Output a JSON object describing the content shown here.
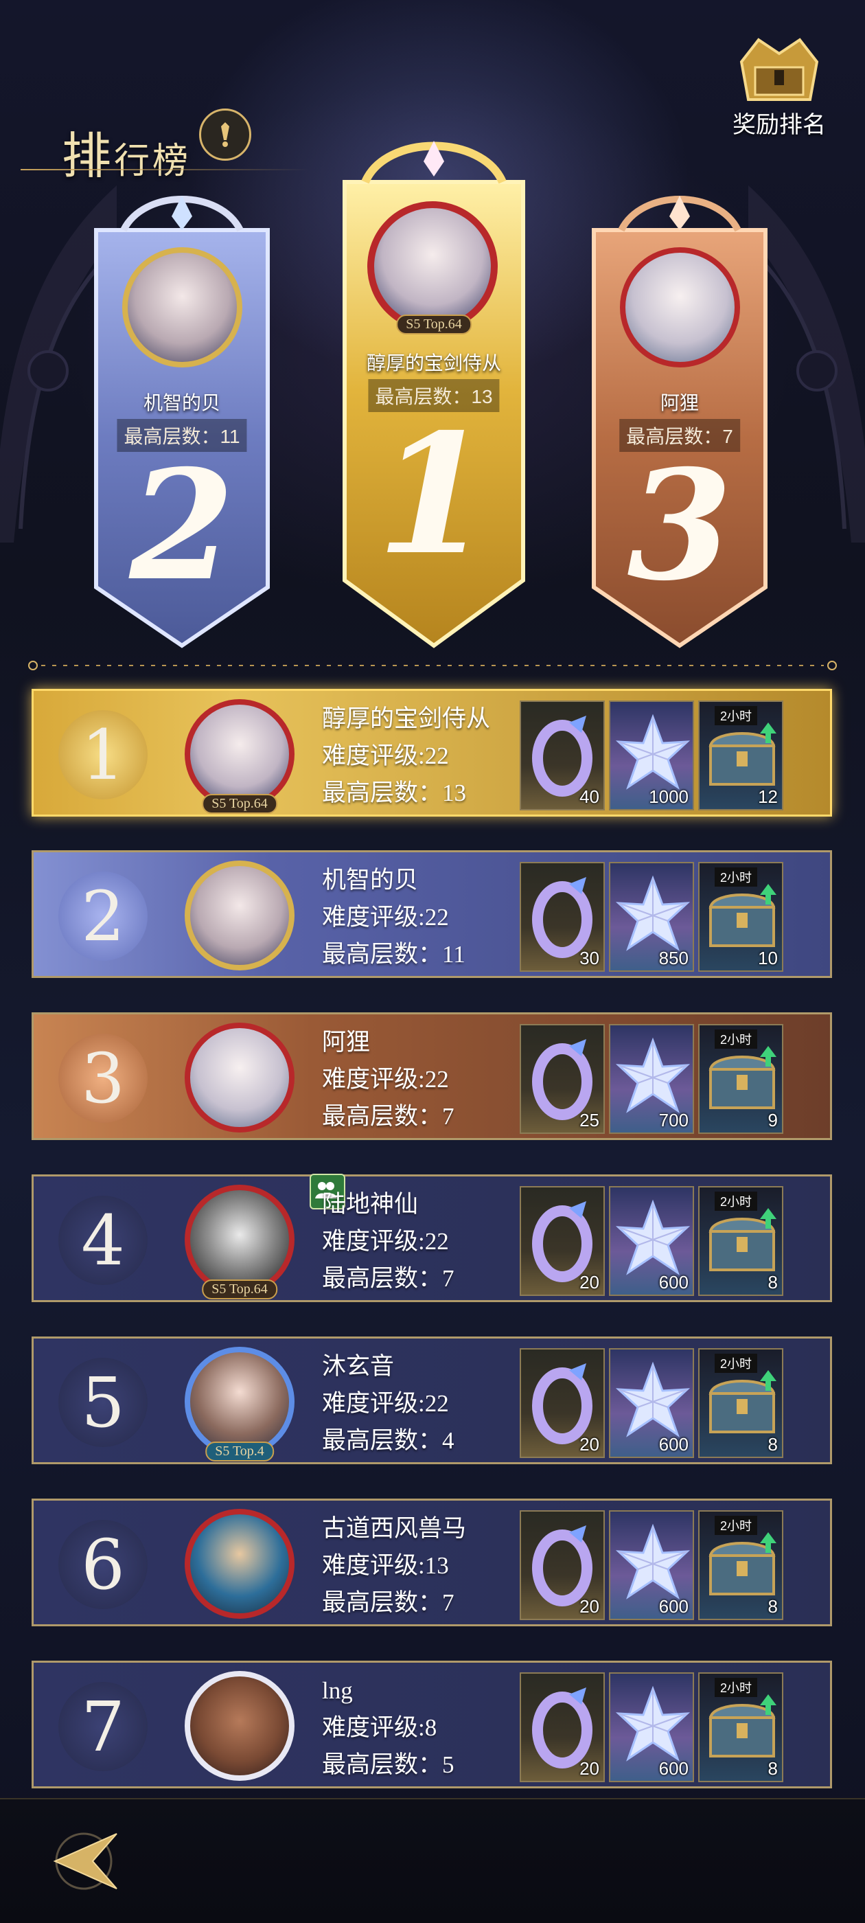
{
  "header": {
    "title_first": "排",
    "title_rest": "行榜",
    "info_icon": "exclamation-icon"
  },
  "reward_rank": {
    "label": "奖励排名",
    "icon": "treasure-chest-icon"
  },
  "podium": [
    {
      "rank": "2",
      "name": "机智的贝",
      "floor": "最高层数：11",
      "badge": ""
    },
    {
      "rank": "1",
      "name": "醇厚的宝剑侍从",
      "floor": "最高层数：13",
      "badge": "S5 Top.64"
    },
    {
      "rank": "3",
      "name": "阿狸",
      "floor": "最高层数：7",
      "badge": ""
    }
  ],
  "rows": [
    {
      "rank": "1",
      "name": "醇厚的宝剑侍从",
      "difficulty": "难度评级:22",
      "floor": "最高层数：13",
      "badge": "S5 Top.64",
      "rewards": [
        "40",
        "1000",
        "12"
      ],
      "chest_tag": "2小时"
    },
    {
      "rank": "2",
      "name": "机智的贝",
      "difficulty": "难度评级:22",
      "floor": "最高层数：11",
      "badge": "",
      "rewards": [
        "30",
        "850",
        "10"
      ],
      "chest_tag": "2小时"
    },
    {
      "rank": "3",
      "name": "阿狸",
      "difficulty": "难度评级:22",
      "floor": "最高层数：7",
      "badge": "",
      "rewards": [
        "25",
        "700",
        "9"
      ],
      "chest_tag": "2小时"
    },
    {
      "rank": "4",
      "name": "陆地神仙",
      "difficulty": "难度评级:22",
      "floor": "最高层数：7",
      "badge": "S5 Top.64",
      "rewards": [
        "20",
        "600",
        "8"
      ],
      "chest_tag": "2小时"
    },
    {
      "rank": "5",
      "name": "沐玄音",
      "difficulty": "难度评级:22",
      "floor": "最高层数：4",
      "badge": "S5 Top.4",
      "rewards": [
        "20",
        "600",
        "8"
      ],
      "chest_tag": "2小时"
    },
    {
      "rank": "6",
      "name": "古道西风兽马",
      "difficulty": "难度评级:13",
      "floor": "最高层数：7",
      "badge": "",
      "rewards": [
        "20",
        "600",
        "8"
      ],
      "chest_tag": "2小时"
    },
    {
      "rank": "7",
      "name": "lng",
      "difficulty": "难度评级:8",
      "floor": "最高层数：5",
      "badge": "",
      "rewards": [
        "20",
        "600",
        "8"
      ],
      "chest_tag": "2小时"
    }
  ],
  "colors": {
    "gold": "#e9c15a",
    "silver": "#8e9cd6",
    "bronze": "#b8744a",
    "row_bg": "#2b2f55"
  },
  "bottom": {
    "back_icon": "back-arrow-icon"
  }
}
